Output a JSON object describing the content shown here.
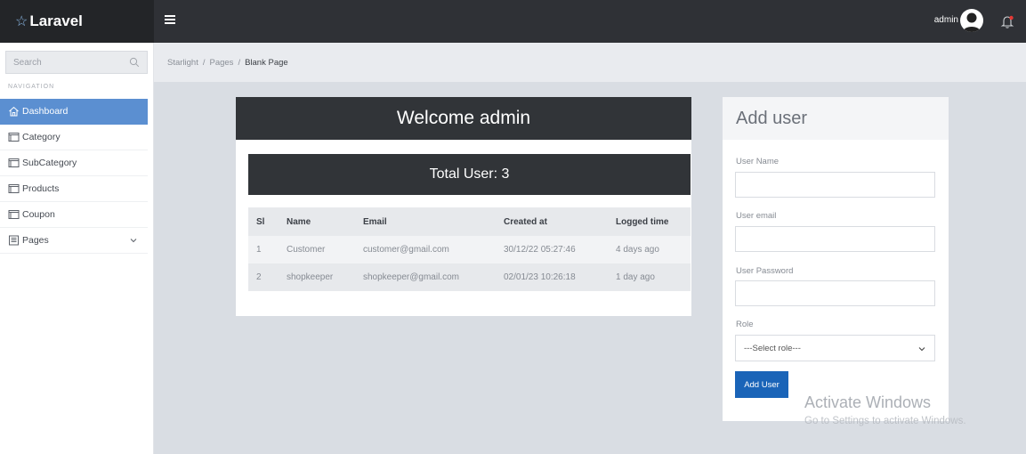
{
  "header": {
    "brand": "Laravel",
    "user_name": "admin"
  },
  "sidebar": {
    "search_placeholder": "Search",
    "nav_heading": "NAVIGATION",
    "items": [
      {
        "label": "Dashboard",
        "icon": "home-icon",
        "active": true
      },
      {
        "label": "Category",
        "icon": "window-icon"
      },
      {
        "label": "SubCategory",
        "icon": "window-icon"
      },
      {
        "label": "Products",
        "icon": "window-icon"
      },
      {
        "label": "Coupon",
        "icon": "window-icon"
      },
      {
        "label": "Pages",
        "icon": "document-icon"
      }
    ]
  },
  "breadcrumb": {
    "items": [
      "Starlight",
      "Pages"
    ],
    "separator": "/",
    "current": "Blank Page"
  },
  "welcome": {
    "title": "Welcome admin",
    "total_users": "Total User: 3"
  },
  "table": {
    "headers": [
      "Sl",
      "Name",
      "Email",
      "Created at",
      "Logged time"
    ],
    "rows": [
      [
        "1",
        "Customer",
        "customer@gmail.com",
        "30/12/22 05:27:46",
        "4 days ago"
      ],
      [
        "2",
        "shopkeeper",
        "shopkeeper@gmail.com",
        "02/01/23 10:26:18",
        "1 day ago"
      ]
    ]
  },
  "add_user": {
    "title": "Add user",
    "name_label": "User Name",
    "email_label": "User email",
    "password_label": "User Password",
    "role_label": "Role",
    "role_selected": "---Select role---",
    "submit_label": "Add User"
  },
  "watermark": {
    "title": "Activate Windows",
    "subtitle": "Go to Settings to activate Windows."
  },
  "colors": {
    "topbar": "#2f3136",
    "sidebar_active": "#5b8fd1",
    "primary_button": "#1a64b8",
    "content_bg": "#d9dde3",
    "notification_dot": "#e53935"
  }
}
